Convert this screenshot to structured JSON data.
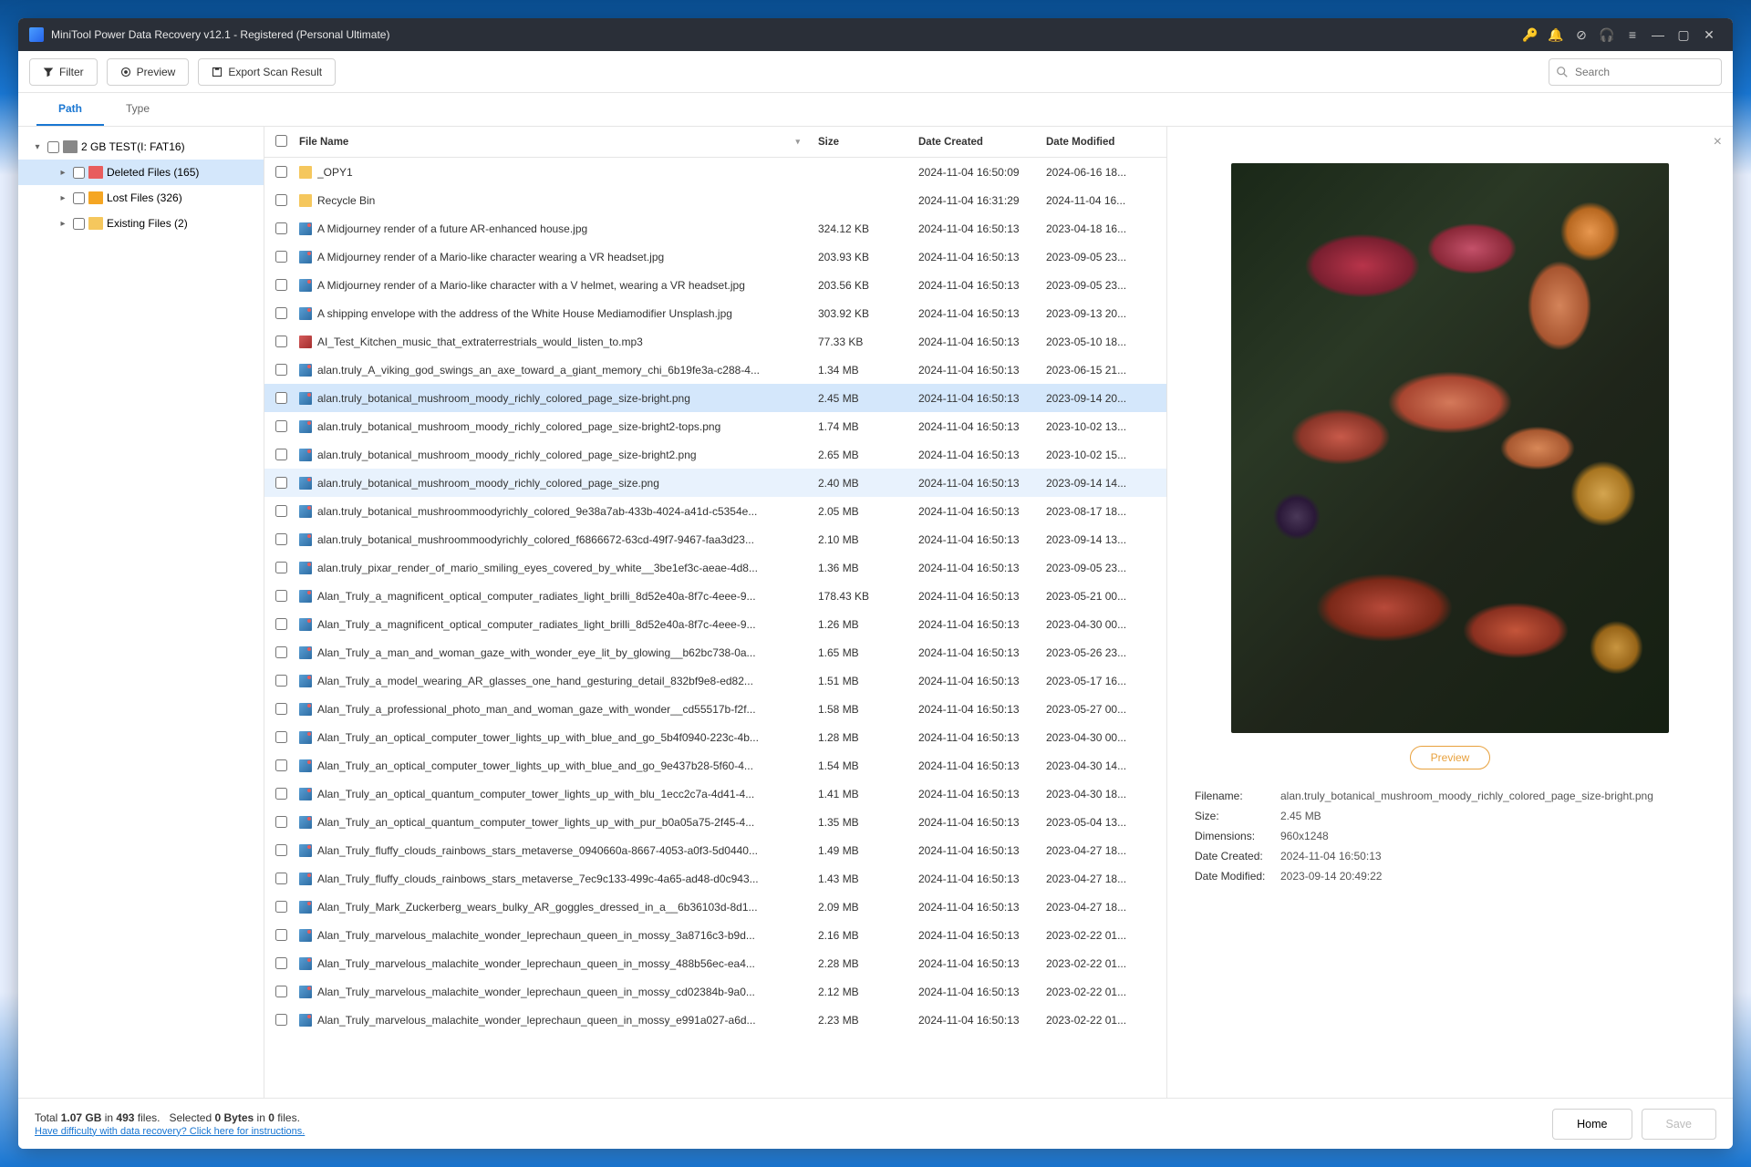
{
  "title": "MiniTool Power Data Recovery v12.1 - Registered (Personal Ultimate)",
  "toolbar": {
    "filter": "Filter",
    "preview": "Preview",
    "export": "Export Scan Result",
    "search_ph": "Search"
  },
  "tabs": {
    "path": "Path",
    "type": "Type"
  },
  "sidebar": {
    "root": "2 GB TEST(I: FAT16)",
    "deleted": "Deleted Files (165)",
    "lost": "Lost Files (326)",
    "existing": "Existing Files (2)"
  },
  "cols": {
    "name": "File Name",
    "size": "Size",
    "dc": "Date Created",
    "dm": "Date Modified"
  },
  "files": [
    {
      "name": "_OPY1",
      "icon": "fld",
      "size": "",
      "dc": "2024-11-04 16:50:09",
      "dm": "2024-06-16 18..."
    },
    {
      "name": "Recycle Bin",
      "icon": "fld",
      "size": "",
      "dc": "2024-11-04 16:31:29",
      "dm": "2024-11-04 16..."
    },
    {
      "name": "A Midjourney render of a future AR-enhanced house.jpg",
      "icon": "img",
      "size": "324.12 KB",
      "dc": "2024-11-04 16:50:13",
      "dm": "2023-04-18 16..."
    },
    {
      "name": "A Midjourney render of a Mario-like character wearing a VR headset.jpg",
      "icon": "img",
      "size": "203.93 KB",
      "dc": "2024-11-04 16:50:13",
      "dm": "2023-09-05 23..."
    },
    {
      "name": "A Midjourney render of a Mario-like character with a V helmet, wearing a VR headset.jpg",
      "icon": "img",
      "size": "203.56 KB",
      "dc": "2024-11-04 16:50:13",
      "dm": "2023-09-05 23..."
    },
    {
      "name": "A shipping envelope with the address of the White House Mediamodifier Unsplash.jpg",
      "icon": "img",
      "size": "303.92 KB",
      "dc": "2024-11-04 16:50:13",
      "dm": "2023-09-13 20..."
    },
    {
      "name": "AI_Test_Kitchen_music_that_extraterrestrials_would_listen_to.mp3",
      "icon": "aud",
      "size": "77.33 KB",
      "dc": "2024-11-04 16:50:13",
      "dm": "2023-05-10 18..."
    },
    {
      "name": "alan.truly_A_viking_god_swings_an_axe_toward_a_giant_memory_chi_6b19fe3a-c288-4...",
      "icon": "img",
      "size": "1.34 MB",
      "dc": "2024-11-04 16:50:13",
      "dm": "2023-06-15 21..."
    },
    {
      "name": "alan.truly_botanical_mushroom_moody_richly_colored_page_size-bright.png",
      "icon": "img",
      "size": "2.45 MB",
      "dc": "2024-11-04 16:50:13",
      "dm": "2023-09-14 20...",
      "sel": true
    },
    {
      "name": "alan.truly_botanical_mushroom_moody_richly_colored_page_size-bright2-tops.png",
      "icon": "img",
      "size": "1.74 MB",
      "dc": "2024-11-04 16:50:13",
      "dm": "2023-10-02 13..."
    },
    {
      "name": "alan.truly_botanical_mushroom_moody_richly_colored_page_size-bright2.png",
      "icon": "img",
      "size": "2.65 MB",
      "dc": "2024-11-04 16:50:13",
      "dm": "2023-10-02 15..."
    },
    {
      "name": "alan.truly_botanical_mushroom_moody_richly_colored_page_size.png",
      "icon": "img",
      "size": "2.40 MB",
      "dc": "2024-11-04 16:50:13",
      "dm": "2023-09-14 14...",
      "sel2": true
    },
    {
      "name": "alan.truly_botanical_mushroommoodyrichly_colored_9e38a7ab-433b-4024-a41d-c5354e...",
      "icon": "img",
      "size": "2.05 MB",
      "dc": "2024-11-04 16:50:13",
      "dm": "2023-08-17 18..."
    },
    {
      "name": "alan.truly_botanical_mushroommoodyrichly_colored_f6866672-63cd-49f7-9467-faa3d23...",
      "icon": "img",
      "size": "2.10 MB",
      "dc": "2024-11-04 16:50:13",
      "dm": "2023-09-14 13..."
    },
    {
      "name": "alan.truly_pixar_render_of_mario_smiling_eyes_covered_by_white__3be1ef3c-aeae-4d8...",
      "icon": "img",
      "size": "1.36 MB",
      "dc": "2024-11-04 16:50:13",
      "dm": "2023-09-05 23..."
    },
    {
      "name": "Alan_Truly_a_magnificent_optical_computer_radiates_light_brilli_8d52e40a-8f7c-4eee-9...",
      "icon": "img",
      "size": "178.43 KB",
      "dc": "2024-11-04 16:50:13",
      "dm": "2023-05-21 00..."
    },
    {
      "name": "Alan_Truly_a_magnificent_optical_computer_radiates_light_brilli_8d52e40a-8f7c-4eee-9...",
      "icon": "img",
      "size": "1.26 MB",
      "dc": "2024-11-04 16:50:13",
      "dm": "2023-04-30 00..."
    },
    {
      "name": "Alan_Truly_a_man_and_woman_gaze_with_wonder_eye_lit_by_glowing__b62bc738-0a...",
      "icon": "img",
      "size": "1.65 MB",
      "dc": "2024-11-04 16:50:13",
      "dm": "2023-05-26 23..."
    },
    {
      "name": "Alan_Truly_a_model_wearing_AR_glasses_one_hand_gesturing_detail_832bf9e8-ed82...",
      "icon": "img",
      "size": "1.51 MB",
      "dc": "2024-11-04 16:50:13",
      "dm": "2023-05-17 16..."
    },
    {
      "name": "Alan_Truly_a_professional_photo_man_and_woman_gaze_with_wonder__cd55517b-f2f...",
      "icon": "img",
      "size": "1.58 MB",
      "dc": "2024-11-04 16:50:13",
      "dm": "2023-05-27 00..."
    },
    {
      "name": "Alan_Truly_an_optical_computer_tower_lights_up_with_blue_and_go_5b4f0940-223c-4b...",
      "icon": "img",
      "size": "1.28 MB",
      "dc": "2024-11-04 16:50:13",
      "dm": "2023-04-30 00..."
    },
    {
      "name": "Alan_Truly_an_optical_computer_tower_lights_up_with_blue_and_go_9e437b28-5f60-4...",
      "icon": "img",
      "size": "1.54 MB",
      "dc": "2024-11-04 16:50:13",
      "dm": "2023-04-30 14..."
    },
    {
      "name": "Alan_Truly_an_optical_quantum_computer_tower_lights_up_with_blu_1ecc2c7a-4d41-4...",
      "icon": "img",
      "size": "1.41 MB",
      "dc": "2024-11-04 16:50:13",
      "dm": "2023-04-30 18..."
    },
    {
      "name": "Alan_Truly_an_optical_quantum_computer_tower_lights_up_with_pur_b0a05a75-2f45-4...",
      "icon": "img",
      "size": "1.35 MB",
      "dc": "2024-11-04 16:50:13",
      "dm": "2023-05-04 13..."
    },
    {
      "name": "Alan_Truly_fluffy_clouds_rainbows_stars_metaverse_0940660a-8667-4053-a0f3-5d0440...",
      "icon": "img",
      "size": "1.49 MB",
      "dc": "2024-11-04 16:50:13",
      "dm": "2023-04-27 18..."
    },
    {
      "name": "Alan_Truly_fluffy_clouds_rainbows_stars_metaverse_7ec9c133-499c-4a65-ad48-d0c943...",
      "icon": "img",
      "size": "1.43 MB",
      "dc": "2024-11-04 16:50:13",
      "dm": "2023-04-27 18..."
    },
    {
      "name": "Alan_Truly_Mark_Zuckerberg_wears_bulky_AR_goggles_dressed_in_a__6b36103d-8d1...",
      "icon": "img",
      "size": "2.09 MB",
      "dc": "2024-11-04 16:50:13",
      "dm": "2023-04-27 18..."
    },
    {
      "name": "Alan_Truly_marvelous_malachite_wonder_leprechaun_queen_in_mossy_3a8716c3-b9d...",
      "icon": "img",
      "size": "2.16 MB",
      "dc": "2024-11-04 16:50:13",
      "dm": "2023-02-22 01..."
    },
    {
      "name": "Alan_Truly_marvelous_malachite_wonder_leprechaun_queen_in_mossy_488b56ec-ea4...",
      "icon": "img",
      "size": "2.28 MB",
      "dc": "2024-11-04 16:50:13",
      "dm": "2023-02-22 01..."
    },
    {
      "name": "Alan_Truly_marvelous_malachite_wonder_leprechaun_queen_in_mossy_cd02384b-9a0...",
      "icon": "img",
      "size": "2.12 MB",
      "dc": "2024-11-04 16:50:13",
      "dm": "2023-02-22 01..."
    },
    {
      "name": "Alan_Truly_marvelous_malachite_wonder_leprechaun_queen_in_mossy_e991a027-a6d...",
      "icon": "img",
      "size": "2.23 MB",
      "dc": "2024-11-04 16:50:13",
      "dm": "2023-02-22 01..."
    }
  ],
  "preview": {
    "btn": "Preview",
    "meta": [
      {
        "k": "Filename:",
        "v": "alan.truly_botanical_mushroom_moody_richly_colored_page_size-bright.png"
      },
      {
        "k": "Size:",
        "v": "2.45 MB"
      },
      {
        "k": "Dimensions:",
        "v": "960x1248"
      },
      {
        "k": "Date Created:",
        "v": "2024-11-04 16:50:13"
      },
      {
        "k": "Date Modified:",
        "v": "2023-09-14 20:49:22"
      }
    ]
  },
  "footer": {
    "stats_html": "Total <b>1.07 GB</b> in <b>493</b> files. &nbsp; Selected <b>0 Bytes</b> in <b>0</b> files.",
    "help": "Have difficulty with data recovery? Click here for instructions.",
    "home": "Home",
    "save": "Save"
  }
}
